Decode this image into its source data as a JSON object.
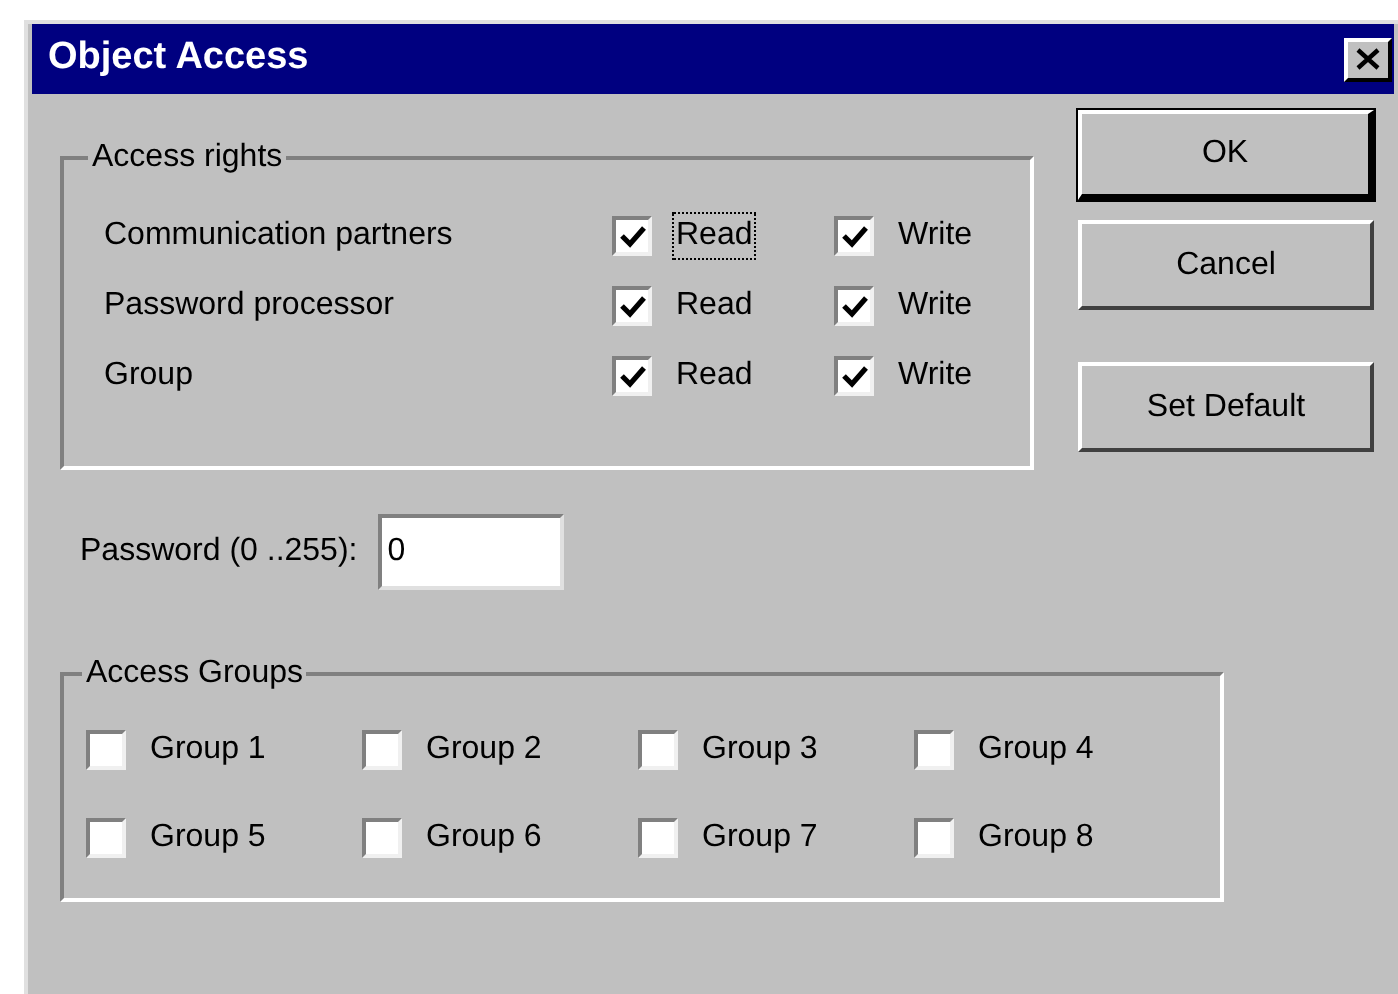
{
  "window": {
    "title": "Object Access"
  },
  "access_rights": {
    "title": "Access rights",
    "rows": [
      {
        "label": "Communication partners",
        "read": {
          "label": "Read",
          "checked": true,
          "focused": true
        },
        "write": {
          "label": "Write",
          "checked": true,
          "focused": false
        }
      },
      {
        "label": "Password processor",
        "read": {
          "label": "Read",
          "checked": true,
          "focused": false
        },
        "write": {
          "label": "Write",
          "checked": true,
          "focused": false
        }
      },
      {
        "label": "Group",
        "read": {
          "label": "Read",
          "checked": true,
          "focused": false
        },
        "write": {
          "label": "Write",
          "checked": true,
          "focused": false
        }
      }
    ]
  },
  "buttons": [
    {
      "label": "OK",
      "default": true
    },
    {
      "label": "Cancel",
      "default": false
    },
    {
      "label": "Set Default",
      "default": false
    }
  ],
  "password": {
    "label": "Password (0 ..255):",
    "value": "0"
  },
  "access_groups": {
    "title": "Access Groups",
    "items": [
      {
        "label": "Group 1",
        "checked": false
      },
      {
        "label": "Group 2",
        "checked": false
      },
      {
        "label": "Group 3",
        "checked": false
      },
      {
        "label": "Group 4",
        "checked": false
      },
      {
        "label": "Group 5",
        "checked": false
      },
      {
        "label": "Group 6",
        "checked": false
      },
      {
        "label": "Group 7",
        "checked": false
      },
      {
        "label": "Group 8",
        "checked": false
      }
    ]
  }
}
